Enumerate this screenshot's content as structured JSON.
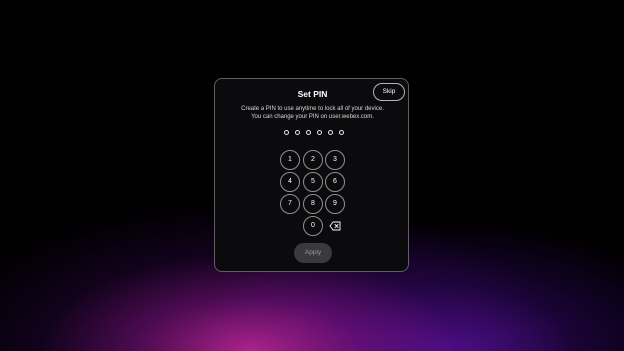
{
  "dialog": {
    "title": "Set PIN",
    "skip_label": "Skip",
    "description_line1": "Create a PIN to use anytime to lock all of your device.",
    "description_line2": "You can change your PIN on user.webex.com.",
    "pin_length": 6,
    "keypad": {
      "key_1": "1",
      "key_2": "2",
      "key_3": "3",
      "key_4": "4",
      "key_5": "5",
      "key_6": "6",
      "key_7": "7",
      "key_8": "8",
      "key_9": "9",
      "key_0": "0",
      "backspace_icon": "backspace-icon"
    },
    "apply_label": "Apply"
  },
  "colors": {
    "background": "#000000",
    "glow_pink": "#c828a0",
    "glow_purple": "#6e14c8",
    "apply_disabled_bg": "#3a3a3e",
    "apply_disabled_text": "#9a9a9e"
  }
}
